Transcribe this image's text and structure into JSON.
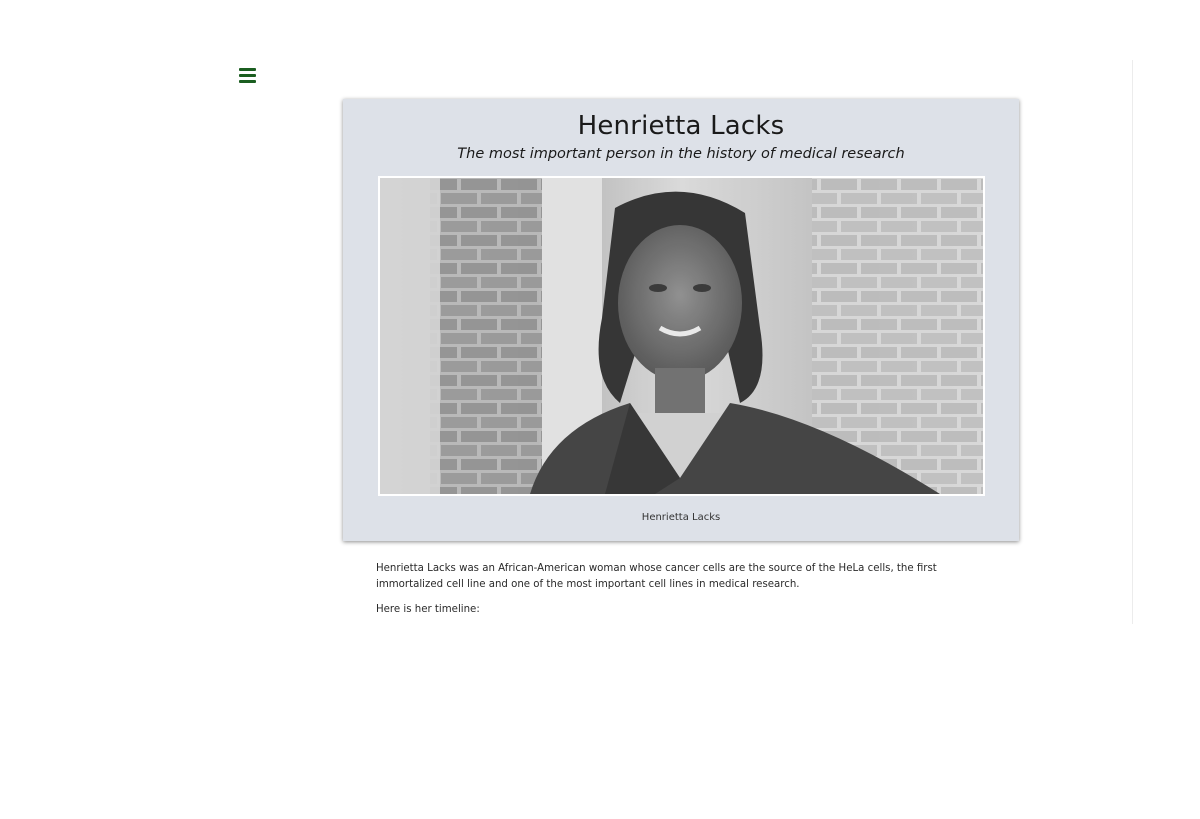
{
  "nav": {
    "menu_icon": "hamburger-menu-icon",
    "menu_color": "#1b5e20"
  },
  "hero": {
    "title": "Henrietta Lacks",
    "subtitle": "The most important person in the history of medical research",
    "image_caption": "Henrietta Lacks",
    "background_color": "#dde1e8"
  },
  "content": {
    "intro": "Henrietta Lacks was an African-American woman whose cancer cells are the source of the HeLa cells, the first immortalized cell line and one of the most important cell lines in medical research.",
    "timeline_lead": "Here is her timeline:"
  }
}
